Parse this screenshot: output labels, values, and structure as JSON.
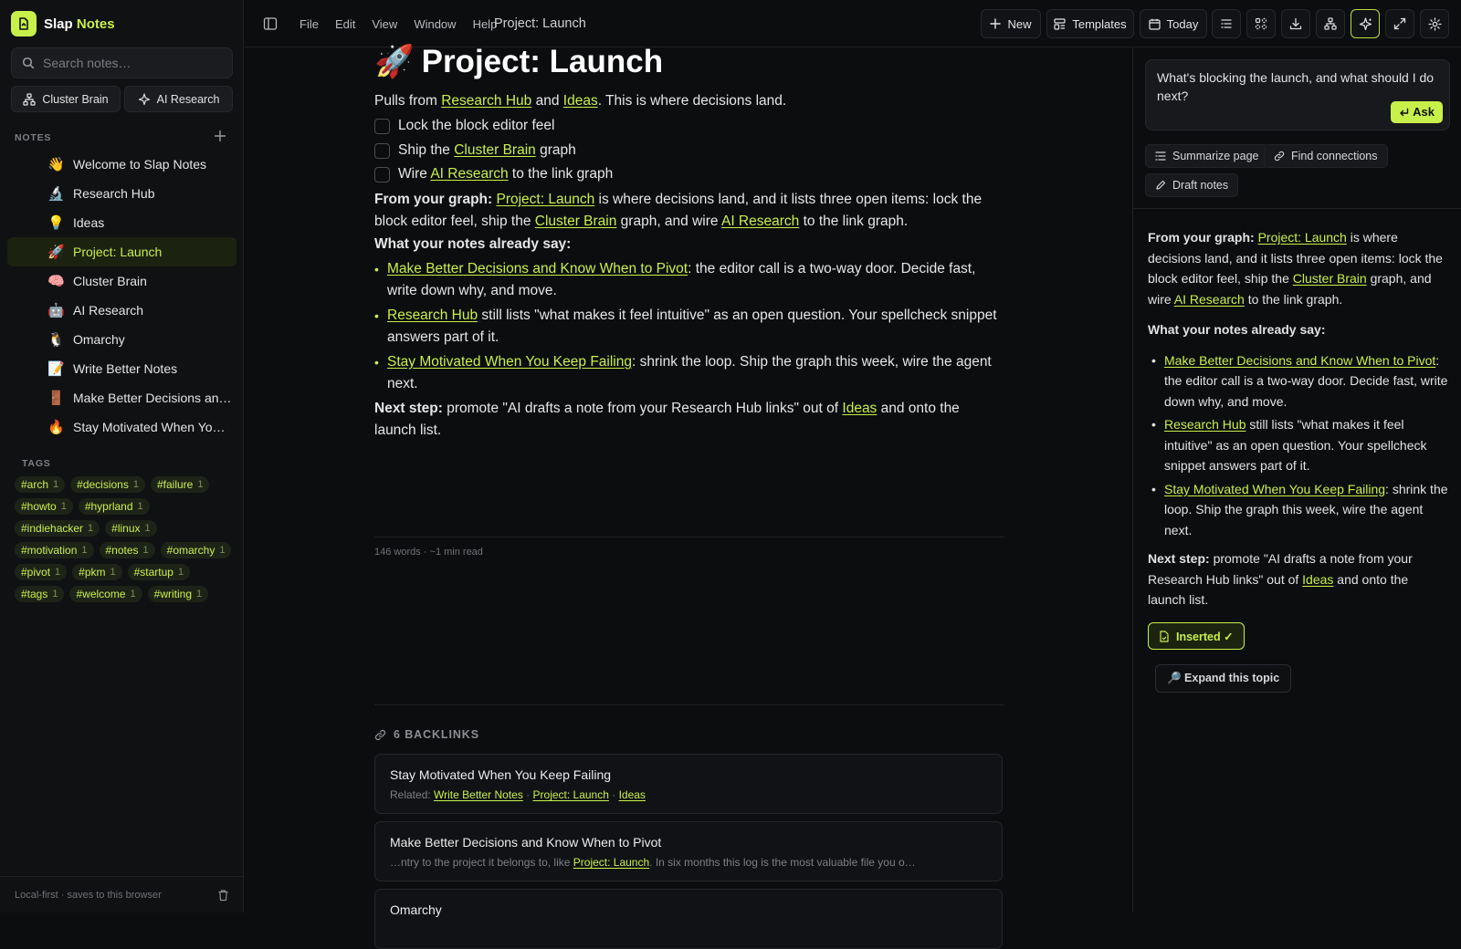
{
  "brand": {
    "name_first": "Slap",
    "name_second": "Notes"
  },
  "search": {
    "placeholder": "Search notes…"
  },
  "quick_buttons": [
    {
      "label": "Cluster Brain",
      "icon": "graph-icon"
    },
    {
      "label": "AI Research",
      "icon": "sparkle-icon"
    }
  ],
  "notes_section": {
    "label": "NOTES"
  },
  "notes": [
    {
      "emoji": "👋",
      "title": "Welcome to Slap Notes",
      "active": false
    },
    {
      "emoji": "🔬",
      "title": "Research Hub",
      "active": false
    },
    {
      "emoji": "💡",
      "title": "Ideas",
      "active": false
    },
    {
      "emoji": "🚀",
      "title": "Project: Launch",
      "active": true
    },
    {
      "emoji": "🧠",
      "title": "Cluster Brain",
      "active": false
    },
    {
      "emoji": "🤖",
      "title": "AI Research",
      "active": false
    },
    {
      "emoji": "🐧",
      "title": "Omarchy",
      "active": false
    },
    {
      "emoji": "📝",
      "title": "Write Better Notes",
      "active": false
    },
    {
      "emoji": "🚪",
      "title": "Make Better Decisions and Know When to Pivot",
      "active": false
    },
    {
      "emoji": "🔥",
      "title": "Stay Motivated When You Keep Failing",
      "active": false
    }
  ],
  "tags_section": {
    "label": "TAGS"
  },
  "tags": [
    {
      "name": "#arch",
      "count": "1"
    },
    {
      "name": "#decisions",
      "count": "1"
    },
    {
      "name": "#failure",
      "count": "1"
    },
    {
      "name": "#howto",
      "count": "1"
    },
    {
      "name": "#hyprland",
      "count": "1"
    },
    {
      "name": "#indiehacker",
      "count": "1"
    },
    {
      "name": "#linux",
      "count": "1"
    },
    {
      "name": "#motivation",
      "count": "1"
    },
    {
      "name": "#notes",
      "count": "1"
    },
    {
      "name": "#omarchy",
      "count": "1"
    },
    {
      "name": "#pivot",
      "count": "1"
    },
    {
      "name": "#pkm",
      "count": "1"
    },
    {
      "name": "#startup",
      "count": "1"
    },
    {
      "name": "#tags",
      "count": "1"
    },
    {
      "name": "#welcome",
      "count": "1"
    },
    {
      "name": "#writing",
      "count": "1"
    }
  ],
  "sidebar_footer": {
    "text": "Local-first · saves to this browser"
  },
  "menu": [
    "File",
    "Edit",
    "View",
    "Window",
    "Help"
  ],
  "topbar": {
    "doc_title": "Project: Launch",
    "new_label": "New",
    "templates_label": "Templates",
    "today_label": "Today"
  },
  "editor": {
    "title_emoji": "🚀",
    "title": "Project: Launch",
    "intro": {
      "t1": "Pulls from ",
      "l1": "Research Hub",
      "t2": " and ",
      "l2": "Ideas",
      "t3": ". This is where decisions land."
    },
    "checklist": [
      {
        "pre": "Lock the block editor feel",
        "link": "",
        "post": ""
      },
      {
        "pre": "Ship the ",
        "link": "Cluster Brain",
        "post": " graph"
      },
      {
        "pre": "Wire ",
        "link": "AI Research",
        "post": " to the link graph"
      }
    ],
    "from_graph": {
      "label": "From your graph:",
      "l1": "Project: Launch",
      "t1": " is where decisions land, and it lists three open items: lock the block editor feel, ship the ",
      "l2": "Cluster Brain",
      "t2": " graph, and wire ",
      "l3": "AI Research",
      "t3": " to the link graph."
    },
    "notes_say": {
      "label": "What your notes already say:"
    },
    "bullets": [
      {
        "link": "Make Better Decisions and Know When to Pivot",
        "text": ": the editor call is a two-way door. Decide fast, write down why, and move."
      },
      {
        "link": "Research Hub",
        "text": " still lists \"what makes it feel intuitive\" as an open question. Your spellcheck snippet answers part of it."
      },
      {
        "link": "Stay Motivated When You Keep Failing",
        "text": ": shrink the loop. Ship the graph this week, wire the agent next."
      }
    ],
    "next_step": {
      "label": "Next step:",
      "t1": " promote \"AI drafts a note from your Research Hub links\" out of ",
      "link": "Ideas",
      "t2": " and onto the launch list."
    },
    "word_count": "146 words · ~1 min read",
    "backlinks_label": "6 BACKLINKS",
    "backlinks": [
      {
        "title": "Stay Motivated When You Keep Failing",
        "prefix": "Related: ",
        "links": [
          "Write Better Notes",
          "Project: Launch",
          "Ideas"
        ],
        "sep": " · "
      },
      {
        "title": "Make Better Decisions and Know When to Pivot",
        "pre": "…ntry to the project it belongs to, like ",
        "link": "Project: Launch",
        "post": ". In six months this log is the most valuable file you o…"
      },
      {
        "title": "Omarchy"
      }
    ]
  },
  "ai_panel": {
    "question": "What's blocking the launch, and what should I do next?",
    "ask_label": "Ask",
    "chips": [
      "Summarize page",
      "Find connections",
      "Draft notes"
    ],
    "answer": {
      "from_label": "From your graph:",
      "l1": "Project: Launch",
      "t1": " is where decisions land, and it lists three open items: lock the block editor feel, ship the ",
      "l2": "Cluster Brain",
      "t2": " graph, and wire ",
      "l3": "AI Research",
      "t3": " to the link graph.",
      "say_label": "What your notes already say:",
      "bullets": [
        {
          "link": "Make Better Decisions and Know When to Pivot",
          "text": ": the editor call is a two-way door. Decide fast, write down why, and move."
        },
        {
          "link": "Research Hub",
          "text": " still lists \"what makes it feel intuitive\" as an open question. Your spellcheck snippet answers part of it."
        },
        {
          "link": "Stay Motivated When You Keep Failing",
          "text": ": shrink the loop. Ship the graph this week, wire the agent next."
        }
      ],
      "next_label": "Next step:",
      "n1": " promote \"AI drafts a note from your Research Hub links\" out of ",
      "nlink": "Ideas",
      "n2": " and onto the launch list."
    },
    "inserted_label": "Inserted ✓",
    "expand_label": "🔎 Expand this topic"
  },
  "colors": {
    "accent": "#c8f04a",
    "background": "#0c0d0f",
    "sidebar": "#101113"
  }
}
